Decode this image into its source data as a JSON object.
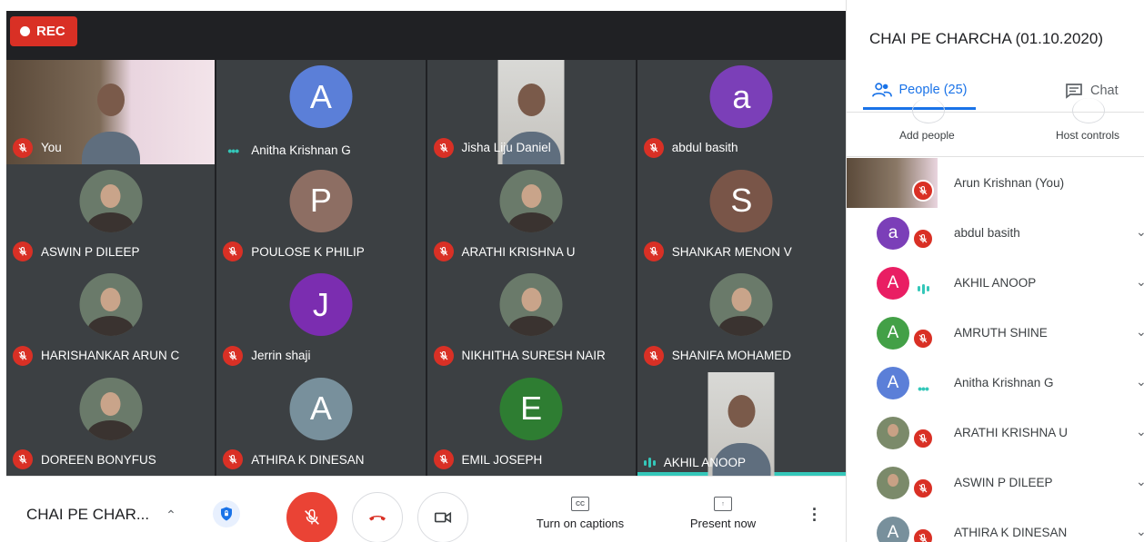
{
  "recording": {
    "label": "REC"
  },
  "tiles": [
    {
      "name": "You",
      "kind": "video-full",
      "status": "muted",
      "speaking": false
    },
    {
      "name": "Anitha Krishnan G",
      "kind": "letter",
      "letter": "A",
      "color": "#5b7fd8",
      "status": "dots",
      "speaking": false
    },
    {
      "name": "Jisha Liju Daniel",
      "kind": "video-center",
      "status": "muted",
      "speaking": false
    },
    {
      "name": "abdul basith",
      "kind": "letter",
      "letter": "a",
      "color": "#7b3fb8",
      "status": "muted",
      "speaking": false
    },
    {
      "name": "ASWIN P DILEEP",
      "kind": "photo",
      "status": "muted",
      "speaking": false
    },
    {
      "name": "POULOSE K PHILIP",
      "kind": "letter",
      "letter": "P",
      "color": "#8d6e63",
      "status": "muted",
      "speaking": false
    },
    {
      "name": "ARATHI KRISHNA U",
      "kind": "photo",
      "status": "muted",
      "speaking": false
    },
    {
      "name": "SHANKAR MENON V",
      "kind": "letter",
      "letter": "S",
      "color": "#795548",
      "status": "muted",
      "speaking": false
    },
    {
      "name": "HARISHANKAR ARUN C",
      "kind": "photo",
      "status": "muted",
      "speaking": false
    },
    {
      "name": "Jerrin shaji",
      "kind": "letter",
      "letter": "J",
      "color": "#7b2db0",
      "status": "muted",
      "speaking": false
    },
    {
      "name": "NIKHITHA SURESH NAIR",
      "kind": "photo",
      "status": "muted",
      "speaking": false
    },
    {
      "name": "SHANIFA MOHAMED",
      "kind": "photo",
      "status": "muted",
      "speaking": false
    },
    {
      "name": "DOREEN BONYFUS",
      "kind": "photo",
      "status": "muted",
      "speaking": false
    },
    {
      "name": "ATHIRA K DINESAN",
      "kind": "letter",
      "letter": "A",
      "color": "#78909c",
      "status": "muted",
      "speaking": false
    },
    {
      "name": "EMIL JOSEPH",
      "kind": "letter",
      "letter": "E",
      "color": "#2e7d32",
      "status": "muted",
      "speaking": false
    },
    {
      "name": "AKHIL ANOOP",
      "kind": "video-center",
      "status": "speaking",
      "speaking": true
    }
  ],
  "bottombar": {
    "meeting_title": "CHAI PE CHAR...",
    "captions_label": "Turn on captions",
    "present_label": "Present now"
  },
  "panel": {
    "title": "CHAI PE CHARCHA (01.10.2020)",
    "tab_people": "People (25)",
    "tab_chat": "Chat",
    "add_people": "Add people",
    "host_controls": "Host controls",
    "participants": [
      {
        "name": "Arun Krishnan (You)",
        "kind": "self",
        "status": "muted"
      },
      {
        "name": "abdul basith",
        "kind": "letter",
        "letter": "a",
        "color": "#7b3fb8",
        "status": "muted"
      },
      {
        "name": "AKHIL ANOOP",
        "kind": "letter",
        "letter": "A",
        "color": "#e91e63",
        "status": "speaking"
      },
      {
        "name": "AMRUTH SHINE",
        "kind": "letter",
        "letter": "A",
        "color": "#43a047",
        "status": "muted"
      },
      {
        "name": "Anitha Krishnan G",
        "kind": "letter",
        "letter": "A",
        "color": "#5b7fd8",
        "status": "dots"
      },
      {
        "name": "ARATHI KRISHNA U",
        "kind": "photo",
        "status": "muted"
      },
      {
        "name": "ASWIN P DILEEP",
        "kind": "photo",
        "status": "muted"
      },
      {
        "name": "ATHIRA K DINESAN",
        "kind": "letter",
        "letter": "A",
        "color": "#78909c",
        "status": "muted"
      }
    ]
  }
}
